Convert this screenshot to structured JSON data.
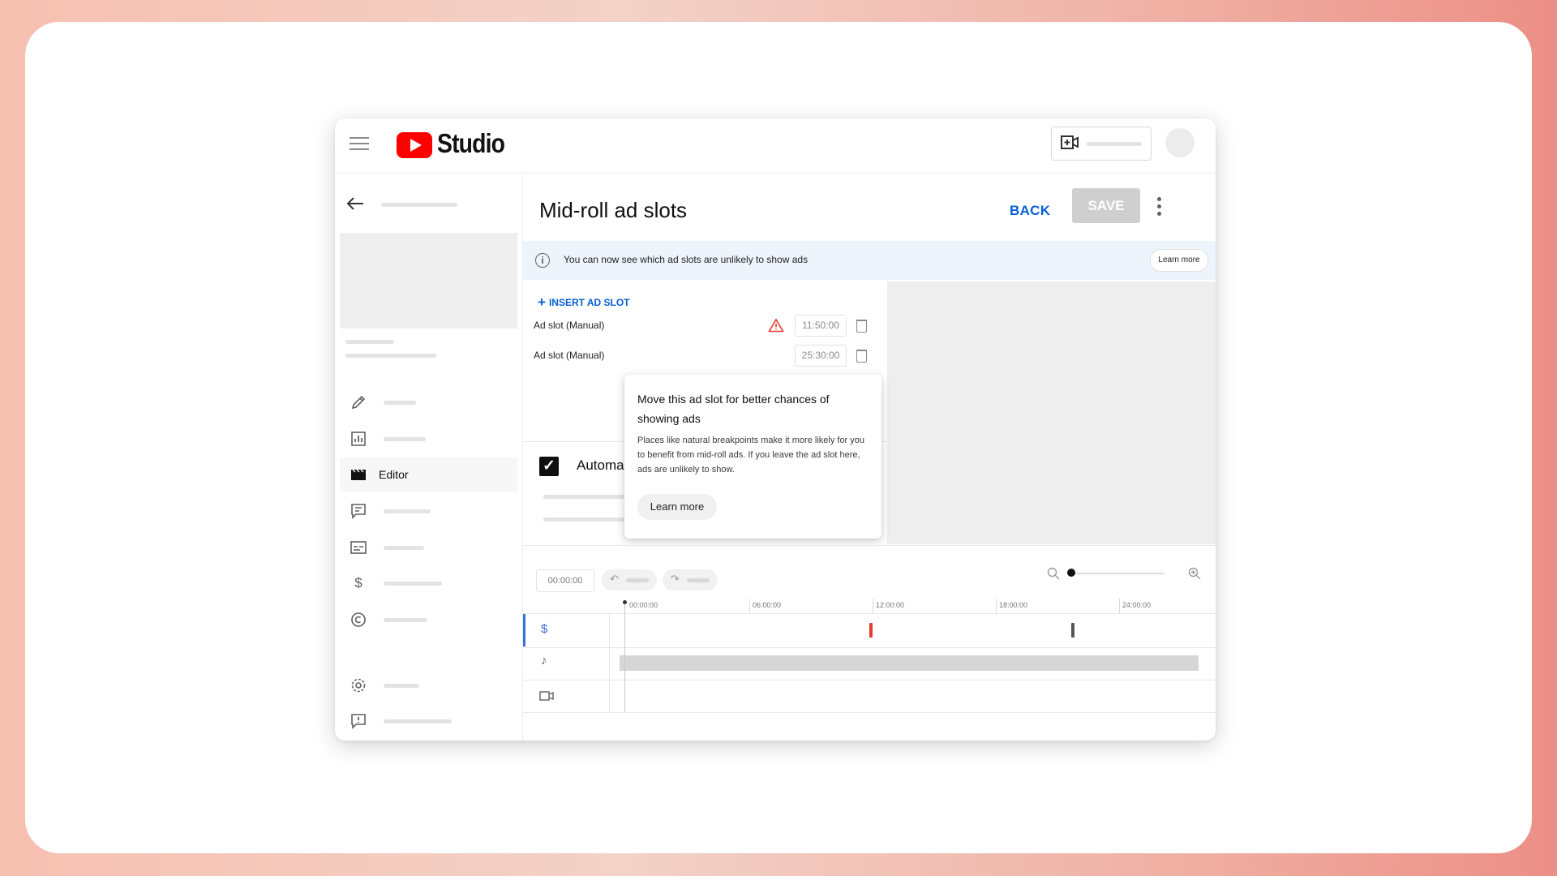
{
  "app": {
    "logo_text": "Studio"
  },
  "page": {
    "title": "Mid-roll ad slots",
    "back_label": "BACK",
    "save_label": "SAVE"
  },
  "sidebar": {
    "active_item_label": "Editor",
    "icons": [
      "back-arrow-icon",
      "pencil-icon",
      "analytics-icon",
      "editor-icon",
      "comments-icon",
      "subtitles-icon",
      "dollar-icon",
      "copyright-icon",
      "settings-icon",
      "feedback-icon"
    ]
  },
  "banner": {
    "text": "You can now see which ad slots are unlikely to show ads",
    "learn_more": "Learn more"
  },
  "ad_slots": {
    "insert_label": "INSERT AD SLOT",
    "rows": [
      {
        "label": "Ad slot (Manual)",
        "time": "11:50:00",
        "warning": true
      },
      {
        "label": "Ad slot (Manual)",
        "time": "25:30:00",
        "warning": false
      }
    ]
  },
  "automatic": {
    "label": "Automa",
    "checked": true
  },
  "tooltip": {
    "title": "Move this ad slot for better chances of showing ads",
    "body": "Places like natural breakpoints make it more likely for you to benefit from mid-roll ads. If you leave the ad slot here, ads are unlikely to show.",
    "button": "Learn more"
  },
  "timeline": {
    "timecode": "00:00:00",
    "ticks": [
      "00:00:00",
      "06:00:00",
      "12:00:00",
      "18:00:00",
      "24:00:00"
    ],
    "tracks": [
      "dollar-icon",
      "music-note-icon",
      "video-icon"
    ]
  },
  "colors": {
    "brand_red": "#ff0000",
    "link_blue": "#065fd4",
    "warning_red": "#e53935"
  }
}
